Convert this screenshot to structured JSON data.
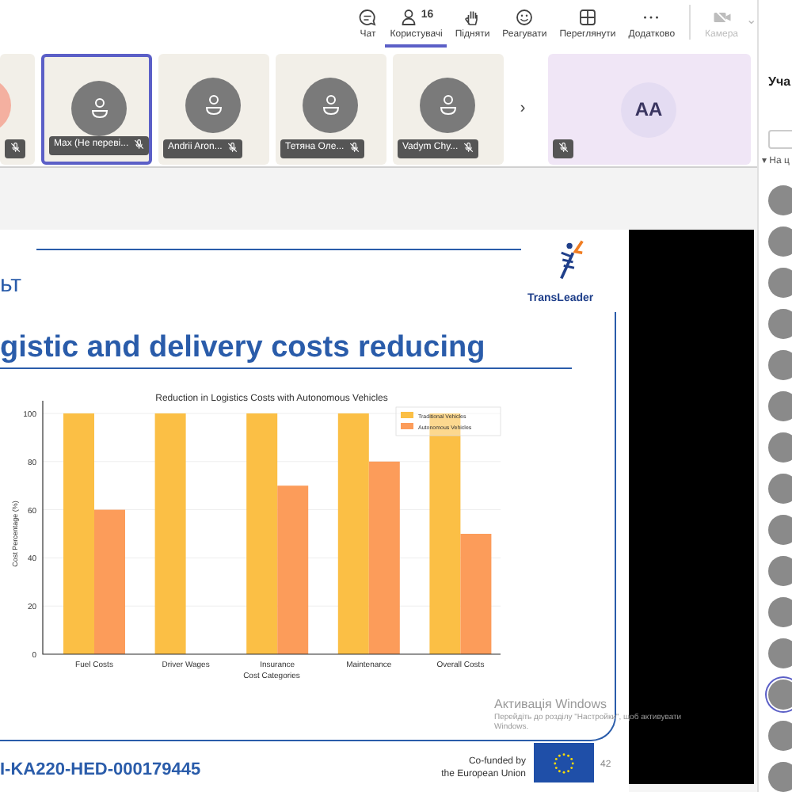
{
  "toolbar": {
    "items": [
      {
        "kind": "chat",
        "label": "Чат",
        "selected": false,
        "disabled": false
      },
      {
        "kind": "people",
        "label": "Користувачі",
        "badge": "16",
        "selected": true,
        "disabled": false
      },
      {
        "kind": "hand",
        "label": "Підняти",
        "selected": false,
        "disabled": false
      },
      {
        "kind": "react",
        "label": "Реагувати",
        "selected": false,
        "disabled": false
      },
      {
        "kind": "view",
        "label": "Переглянути",
        "selected": false,
        "disabled": false
      },
      {
        "kind": "more",
        "label": "Додатково",
        "selected": false,
        "disabled": false
      },
      {
        "kind": "camera",
        "label": "Камера",
        "selected": false,
        "disabled": true
      }
    ],
    "overflow_glyph": "⌄"
  },
  "tiles_next_glyph": "›",
  "tiles": [
    {
      "kind": "partial",
      "selected": false,
      "muted": true
    },
    {
      "kind": "person",
      "name": "Max (Не переві...",
      "selected": true,
      "muted": true
    },
    {
      "kind": "person",
      "name": "Andrii Aron...",
      "selected": false,
      "muted": true
    },
    {
      "kind": "person",
      "name": "Тетяна Оле...",
      "selected": false,
      "muted": true
    },
    {
      "kind": "person",
      "name": "Vadym Chy...",
      "selected": false,
      "muted": true
    },
    {
      "kind": "initials",
      "initials": "AA",
      "selected": false,
      "muted": true
    }
  ],
  "side_panel": {
    "title": "Уча",
    "section_glyph": "▾",
    "section": "На ц",
    "members": [
      {
        "selected": false
      },
      {
        "selected": false
      },
      {
        "selected": false
      },
      {
        "selected": false
      },
      {
        "selected": false
      },
      {
        "selected": false
      },
      {
        "selected": false
      },
      {
        "selected": false
      },
      {
        "selected": false
      },
      {
        "selected": false
      },
      {
        "selected": false
      },
      {
        "selected": false
      },
      {
        "selected": true
      },
      {
        "selected": false
      },
      {
        "selected": false
      }
    ]
  },
  "slide": {
    "corner_text": "ьт",
    "logo_text": "TransLeader",
    "title": "gistic and delivery costs reducing",
    "chart_data": {
      "type": "bar",
      "title": "Reduction in Logistics Costs with Autonomous Vehicles",
      "xlabel": "Cost Categories",
      "ylabel": "Cost Percentage (%)",
      "categories": [
        "Fuel Costs",
        "Driver Wages",
        "Insurance",
        "Maintenance",
        "Overall Costs"
      ],
      "series": [
        {
          "name": "Traditional Vehicles",
          "color": "#fbbf45",
          "values": [
            100,
            100,
            100,
            100,
            100
          ]
        },
        {
          "name": "Autonomous Vehicles",
          "color": "#fc9c5a",
          "values": [
            60,
            0,
            70,
            80,
            50
          ]
        }
      ],
      "ylim": [
        0,
        100
      ],
      "yticks": [
        0,
        20,
        40,
        60,
        80,
        100
      ],
      "grid": true,
      "legend": true
    },
    "footer_code": "I-KA220-HED-000179445",
    "funding_lines": [
      "Co-funded by",
      "the European Union"
    ],
    "page": "42"
  },
  "os_notice": {
    "title": "Активація Windows",
    "text": "Перейдіть до розділу \"Настройки\", щоб активувати Windows."
  }
}
